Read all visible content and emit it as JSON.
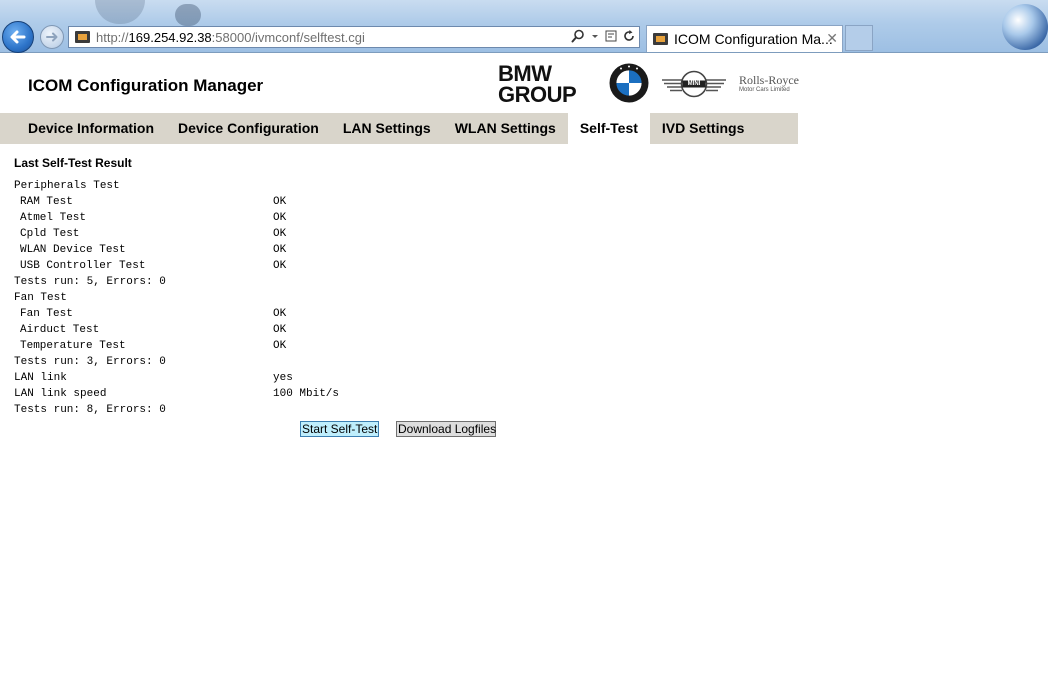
{
  "browser": {
    "url_prefix": "http://",
    "url_host": "169.254.92.38",
    "url_rest": ":58000/ivmconf/selftest.cgi",
    "tab_title": "ICOM Configuration Ma...",
    "tab_close": "✕"
  },
  "header": {
    "title": "ICOM Configuration Manager",
    "logos": {
      "group_line1": "BMW",
      "group_line2": "GROUP",
      "mini": "MINI",
      "rolls_royce": "Rolls-Royce",
      "rolls_royce_sub": "Motor Cars Limited"
    }
  },
  "nav": {
    "tabs": [
      {
        "label": "Device Information"
      },
      {
        "label": "Device Configuration"
      },
      {
        "label": "LAN Settings"
      },
      {
        "label": "WLAN Settings"
      },
      {
        "label": "Self-Test",
        "active": true
      },
      {
        "label": "IVD Settings"
      }
    ]
  },
  "selftest": {
    "heading": "Last Self-Test Result",
    "rows": [
      {
        "label": "Peripherals Test",
        "value": ""
      },
      {
        "label": "RAM Test",
        "value": "OK"
      },
      {
        "label": "Atmel Test",
        "value": "OK"
      },
      {
        "label": "Cpld Test",
        "value": "OK"
      },
      {
        "label": "WLAN Device Test",
        "value": "OK"
      },
      {
        "label": "USB Controller Test",
        "value": "OK"
      },
      {
        "label": "Tests run: 5, Errors: 0",
        "value": ""
      },
      {
        "label": "Fan Test",
        "value": ""
      },
      {
        "label": "Fan Test",
        "value": "OK"
      },
      {
        "label": "Airduct Test",
        "value": "OK"
      },
      {
        "label": "Temperature Test",
        "value": "OK"
      },
      {
        "label": "Tests run: 3, Errors: 0",
        "value": ""
      },
      {
        "label": "LAN link",
        "value": "yes"
      },
      {
        "label": "LAN link speed",
        "value": "100 Mbit/s"
      },
      {
        "label": "Tests run: 8, Errors: 0",
        "value": ""
      }
    ],
    "start_button": "Start Self-Test",
    "download_button": "Download Logfiles"
  }
}
